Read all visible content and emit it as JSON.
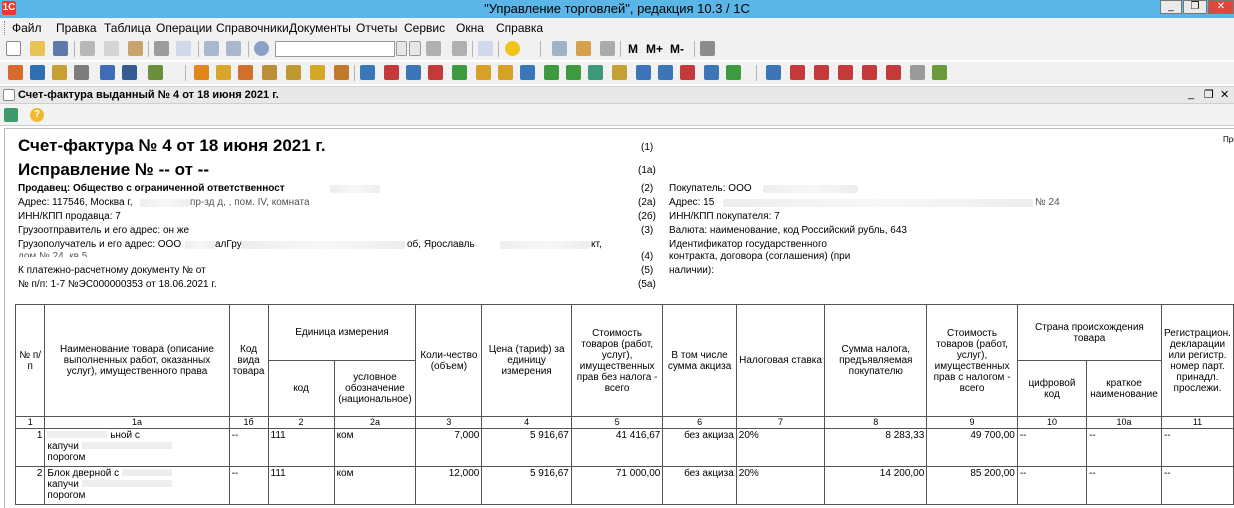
{
  "window": {
    "title": "\"Управление торговлей\", редакция 10.3 / 1С",
    "app_logo": "1С",
    "min_label": "_",
    "restore_label": "❐",
    "close_label": "✕"
  },
  "menu": [
    "Файл",
    "Правка",
    "Таблица",
    "Операции",
    "Справочники",
    "Документы",
    "Отчеты",
    "Сервис",
    "Окна",
    "Справка"
  ],
  "toolbar": {
    "search_value": "",
    "m_label": "M",
    "m_plus_label": "M+",
    "m_minus_label": "M-"
  },
  "document_window": {
    "title": "Счет-фактура выданный № 4 от 18 июня 2021 г.",
    "min_label": "_",
    "restore_label": "❐",
    "close_label": "✕",
    "help_label": "?"
  },
  "invoice": {
    "title": "Счет-фактура № 4 от 18 июня 2021 г.",
    "correction": "Исправление № -- от --",
    "seller": "Продавец: Общество с ограниченной ответственност",
    "seller_address": "Адрес: 117546, Москва г,",
    "seller_address_tail": "пр-зд д,  , пом. IV, комната",
    "seller_inn": "ИНН/КПП продавца: 7",
    "shipper": "Грузоотправитель и его адрес: он же",
    "consignee": "Грузополучатель и его адрес: ООО",
    "consignee_mid": "алГру",
    "consignee_tail": "об, Ярославль",
    "consignee_end": "кт,",
    "consignee_line2": "дом № 24, кв.5",
    "payment_doc": "К платежно-расчетному документу №     от",
    "np_line": "№ п/п: 1-7 №ЭС000000353 от 18.06.2021 г.",
    "codes_left": [
      "(1)",
      "(1а)",
      "(2)",
      "(2а)",
      "(2б)",
      "(3)",
      "(4)",
      "(5)",
      "(5а)"
    ],
    "buyer": "Покупатель: ООО",
    "buyer_address": "Адрес: 15",
    "buyer_address_tail": "№ 24",
    "buyer_inn": "ИНН/КПП покупателя: 7",
    "currency": "Валюта: наименование, код Российский рубль, 643",
    "gov_id_1": "Идентификатор государственного",
    "gov_id_2": "контракта, договора (соглашения) (при",
    "gov_id_3": "наличии):",
    "appendix_note": "При"
  },
  "table": {
    "headers": {
      "num": "№ п/п",
      "name": "Наименование товара (описание выполненных работ, оказанных услуг), имущественного права",
      "kind_code": "Код вида товара",
      "unit_group": "Единица измерения",
      "unit_code": "код",
      "unit_symbol": "условное обозначение (национальное)",
      "qty": "Коли-чество (объем)",
      "price": "Цена (тариф) за единицу измерения",
      "cost_no_tax": "Стоимость товаров (работ, услуг), имущественных прав без налога - всего",
      "excise": "В том числе сумма акциза",
      "tax_rate": "Налоговая ставка",
      "tax_sum": "Сумма налога, предъявляемая покупателю",
      "cost_with_tax": "Стоимость товаров (работ, услуг), имущественных прав с налогом - всего",
      "country_group": "Страна происхождения товара",
      "country_code": "цифровой код",
      "country_name": "краткое наименование",
      "registration": "Регистрацион. декларации или регистр. номер парт. принадл. прослежи."
    },
    "col_numbers": [
      "1",
      "1а",
      "1б",
      "2",
      "2а",
      "3",
      "4",
      "5",
      "6",
      "7",
      "8",
      "9",
      "10",
      "10а",
      "11"
    ],
    "rows": [
      {
        "num": "1",
        "name_line1": "ьной с",
        "name_line2": "капучи",
        "name_line3": "порогом",
        "kind": "--",
        "unit_code": "111",
        "unit": "ком",
        "qty": "7,000",
        "price": "5 916,67",
        "cost": "41 416,67",
        "excise": "без акциза",
        "rate": "20%",
        "tax": "8 283,33",
        "total": "49 700,00",
        "country_code": "--",
        "country_name": "--",
        "reg": "--"
      },
      {
        "num": "2",
        "name_line1": "Блок дверной с",
        "name_line2": "капучи",
        "name_line3": "порогом",
        "kind": "--",
        "unit_code": "111",
        "unit": "ком",
        "qty": "12,000",
        "price": "5 916,67",
        "cost": "71 000,00",
        "excise": "без акциза",
        "rate": "20%",
        "tax": "14 200,00",
        "total": "85 200,00",
        "country_code": "--",
        "country_name": "--",
        "reg": "--"
      }
    ]
  }
}
